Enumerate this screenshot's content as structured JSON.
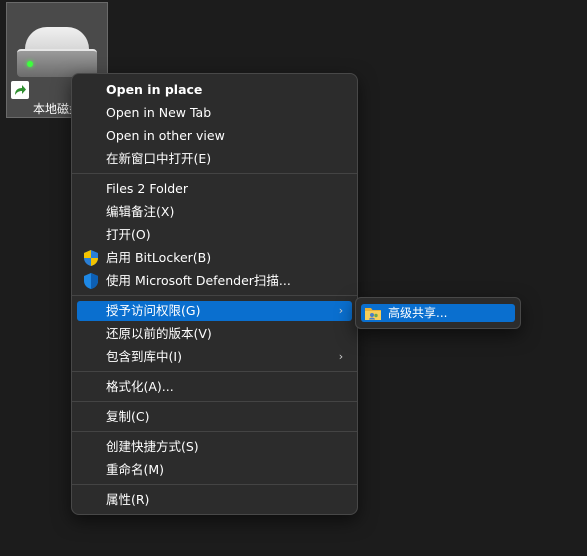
{
  "desktop_icon": {
    "label": "本地磁盘"
  },
  "context_menu": {
    "items": [
      {
        "label": "Open in place"
      },
      {
        "label": "Open in New Tab"
      },
      {
        "label": "Open in other view"
      },
      {
        "label": "在新窗口中打开(E)"
      },
      {
        "label": "Files 2 Folder"
      },
      {
        "label": "编辑备注(X)"
      },
      {
        "label": "打开(O)"
      },
      {
        "label": "启用 BitLocker(B)",
        "icon": "shield-icon"
      },
      {
        "label": "使用 Microsoft Defender扫描...",
        "icon": "defender-shield-icon"
      },
      {
        "label": "授予访问权限(G)",
        "has_submenu": true,
        "highlighted": true
      },
      {
        "label": "还原以前的版本(V)"
      },
      {
        "label": "包含到库中(I)",
        "has_submenu": true
      },
      {
        "label": "格式化(A)..."
      },
      {
        "label": "复制(C)"
      },
      {
        "label": "创建快捷方式(S)"
      },
      {
        "label": "重命名(M)"
      },
      {
        "label": "属性(R)"
      }
    ]
  },
  "submenu": {
    "items": [
      {
        "label": "高级共享...",
        "icon": "shared-folder-icon",
        "highlighted": true
      }
    ]
  },
  "colors": {
    "background": "#1c1c1c",
    "menu_background": "#2c2c2c",
    "highlight": "#0a6fcf"
  }
}
